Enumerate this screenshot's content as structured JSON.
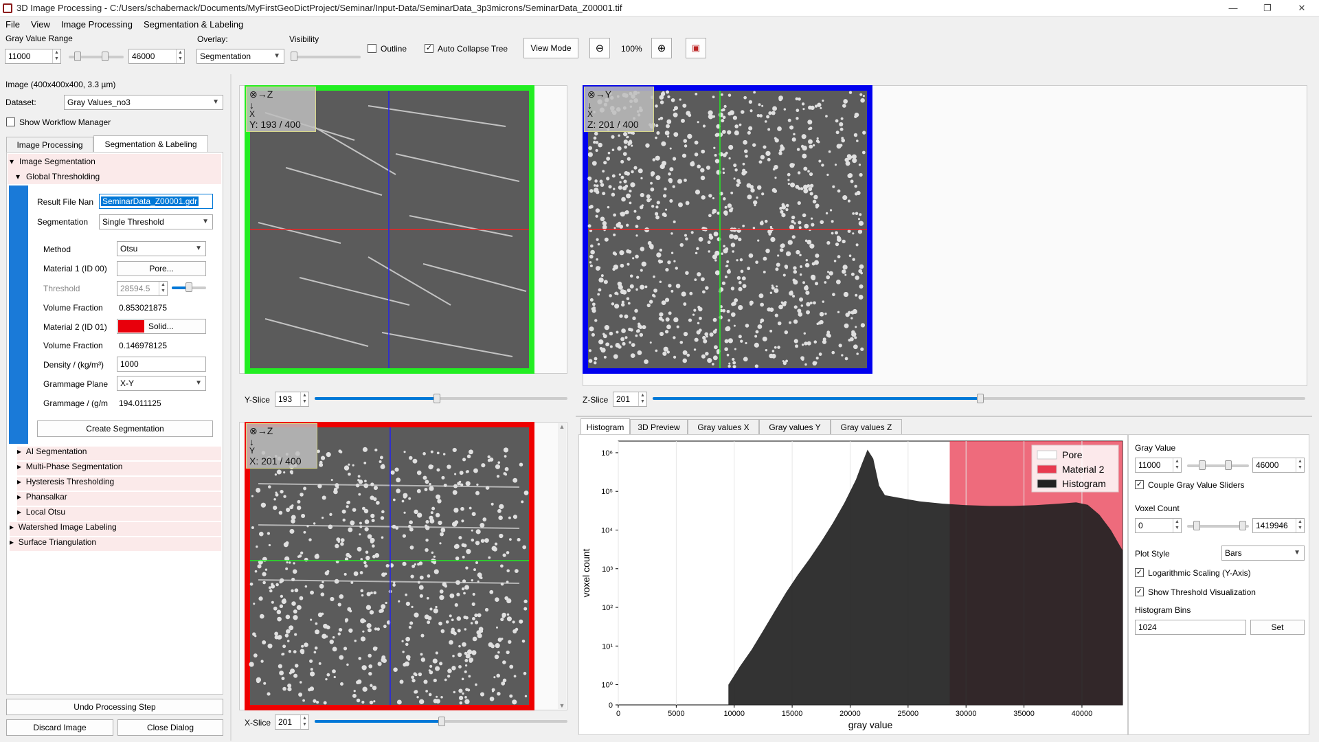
{
  "window": {
    "title": "3D Image Processing - C:/Users/schabernack/Documents/MyFirstGeoDictProject/Seminar/Input-Data/SeminarData_3p3microns/SeminarData_Z00001.tif",
    "minimize": "—",
    "maximize": "❐",
    "close": "✕"
  },
  "menu": [
    "File",
    "View",
    "Image Processing",
    "Segmentation & Labeling"
  ],
  "toolbar": {
    "gray_range_label": "Gray Value Range",
    "gray_min": "11000",
    "gray_max": "46000",
    "overlay_label": "Overlay:",
    "overlay_value": "Segmentation",
    "visibility_label": "Visibility",
    "outline_label": "Outline",
    "auto_collapse_label": "Auto Collapse Tree",
    "view_mode_label": "View Mode",
    "zoom_value": "100%"
  },
  "left": {
    "image_info": "Image (400x400x400, 3.3 µm)",
    "dataset_label": "Dataset:",
    "dataset_value": "Gray Values_no3",
    "workflow_label": "Show Workflow Manager",
    "tabs": [
      "Image Processing",
      "Segmentation & Labeling"
    ],
    "tree_top": "Image Segmentation",
    "tree_sub": "Global Thresholding",
    "result_label": "Result File Nan",
    "result_value": "SeminarData_Z00001.gdr",
    "segmentation_label": "Segmentation",
    "segmentation_value": "Single Threshold",
    "method_label": "Method",
    "method_value": "Otsu",
    "mat1_label": "Material 1 (ID 00)",
    "mat1_btn": "Pore...",
    "threshold_label": "Threshold",
    "threshold_value": "28594.5",
    "vf1_label": "Volume Fraction",
    "vf1_value": "0.853021875",
    "mat2_label": "Material 2 (ID 01)",
    "mat2_btn": "Solid...",
    "mat2_color": "#e8000b",
    "vf2_label": "Volume Fraction",
    "vf2_value": "0.146978125",
    "density_label": "Density / (kg/m³)",
    "density_value": "1000",
    "gplane_label": "Grammage Plane",
    "gplane_value": "X-Y",
    "grammage_label": "Grammage / (g/m",
    "grammage_value": "194.011125",
    "create_btn": "Create Segmentation",
    "tree_items": [
      "AI Segmentation",
      "Multi-Phase Segmentation",
      "Hysteresis Thresholding",
      "Phansalkar",
      "Local Otsu"
    ],
    "tree_items_top": [
      "Watershed Image Labeling",
      "Surface Triangulation"
    ],
    "undo_btn": "Undo Processing Step",
    "discard_btn": "Discard Image",
    "close_btn": "Close Dialog"
  },
  "viewers": {
    "xz": {
      "axis_h": "Z",
      "axis_v": "X",
      "coord": "Y: 193 / 400",
      "slice_label": "Y-Slice",
      "slice_value": "193",
      "slice_level": 0.4825,
      "border": "#22ee22"
    },
    "xy": {
      "axis_h": "Y",
      "axis_v": "X",
      "coord": "Z: 201 / 400",
      "slice_label": "Z-Slice",
      "slice_value": "201",
      "slice_level": 0.5025,
      "border": "#0000ee"
    },
    "yz": {
      "axis_h": "Z",
      "axis_v": "Y",
      "coord": "X: 201 / 400",
      "slice_label": "X-Slice",
      "slice_value": "201",
      "slice_level": 0.5025,
      "border": "#ee0000"
    }
  },
  "hist_tabs": [
    "Histogram",
    "3D Preview",
    "Gray values X",
    "Gray values Y",
    "Gray values Z"
  ],
  "chart_data": {
    "type": "area",
    "xlabel": "gray value",
    "ylabel": "voxel count",
    "xlim": [
      0,
      43500
    ],
    "ylim_log": [
      0.3,
      2000000
    ],
    "log_y": true,
    "x_ticks": [
      0,
      5000,
      10000,
      15000,
      20000,
      25000,
      30000,
      35000,
      40000
    ],
    "y_ticks": [
      "0",
      "10⁰",
      "10¹",
      "10²",
      "10³",
      "10⁴",
      "10⁵",
      "10⁶"
    ],
    "threshold": 28594.5,
    "threshold_color": "#e83a50",
    "legend": [
      {
        "name": "Pore",
        "color": "#ffffff"
      },
      {
        "name": "Material 2",
        "color": "#e83a50"
      },
      {
        "name": "Histogram",
        "color": "#222222"
      }
    ],
    "series": [
      {
        "name": "Histogram",
        "x": [
          9500,
          10500,
          11500,
          12500,
          13500,
          14500,
          15500,
          16500,
          17500,
          18500,
          19500,
          20500,
          21000,
          21500,
          22000,
          22500,
          23000,
          24000,
          26000,
          28000,
          30000,
          32000,
          34000,
          36000,
          38000,
          39500,
          40500,
          41500,
          42500,
          43500
        ],
        "y": [
          1,
          3,
          8,
          25,
          80,
          250,
          700,
          1800,
          5000,
          15000,
          50000,
          200000,
          500000,
          1200000,
          700000,
          140000,
          80000,
          70000,
          55000,
          48000,
          44000,
          42000,
          42000,
          44000,
          48000,
          52000,
          45000,
          25000,
          10000,
          3000
        ]
      }
    ]
  },
  "hist_panel": {
    "gray_label": "Gray Value",
    "gray_min": "11000",
    "gray_max": "46000",
    "couple_label": "Couple Gray Value Sliders",
    "voxel_label": "Voxel Count",
    "voxel_min": "0",
    "voxel_max": "1419946",
    "plot_style_label": "Plot Style",
    "plot_style_value": "Bars",
    "log_label": "Logarithmic Scaling (Y-Axis)",
    "thr_vis_label": "Show Threshold Visualization",
    "bins_label": "Histogram Bins",
    "bins_value": "1024",
    "set_btn": "Set"
  }
}
